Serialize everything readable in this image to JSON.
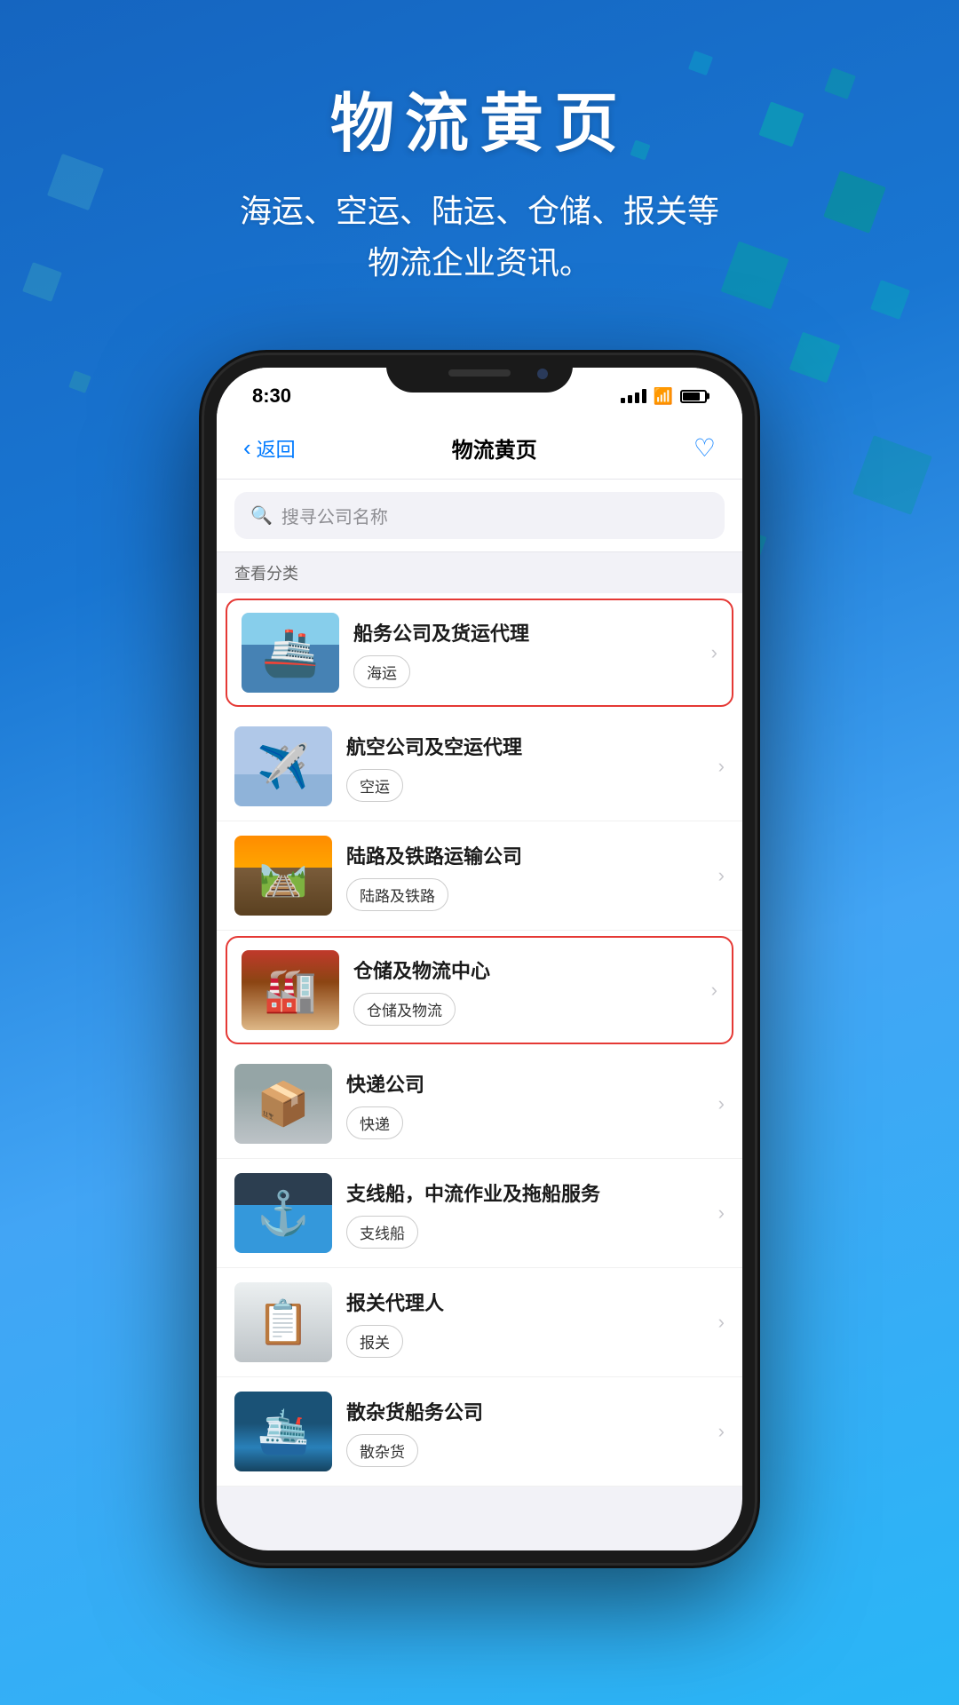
{
  "page": {
    "title": "物流黄页",
    "subtitle_line1": "海运、空运、陆运、仓储、报关等",
    "subtitle_line2": "物流企业资讯。"
  },
  "status_bar": {
    "time": "8:30"
  },
  "nav": {
    "back_label": "返回",
    "title": "物流黄页"
  },
  "search": {
    "placeholder": "搜寻公司名称"
  },
  "category_section": {
    "label": "查看分类"
  },
  "list_items": [
    {
      "id": "shipping",
      "title": "船务公司及货运代理",
      "tag": "海运",
      "highlighted": true,
      "image_type": "ship"
    },
    {
      "id": "airline",
      "title": "航空公司及空运代理",
      "tag": "空运",
      "highlighted": false,
      "image_type": "plane"
    },
    {
      "id": "land",
      "title": "陆路及铁路运输公司",
      "tag": "陆路及铁路",
      "highlighted": false,
      "image_type": "rail"
    },
    {
      "id": "warehouse",
      "title": "仓储及物流中心",
      "tag": "仓储及物流",
      "highlighted": true,
      "image_type": "warehouse"
    },
    {
      "id": "courier",
      "title": "快递公司",
      "tag": "快递",
      "highlighted": false,
      "image_type": "courier"
    },
    {
      "id": "vessel",
      "title": "支线船，中流作业及拖船服务",
      "tag": "支线船",
      "highlighted": false,
      "image_type": "vessel"
    },
    {
      "id": "customs",
      "title": "报关代理人",
      "tag": "报关",
      "highlighted": false,
      "image_type": "customs"
    },
    {
      "id": "bulk",
      "title": "散杂货船务公司",
      "tag": "散杂货",
      "highlighted": false,
      "image_type": "bulk"
    }
  ]
}
